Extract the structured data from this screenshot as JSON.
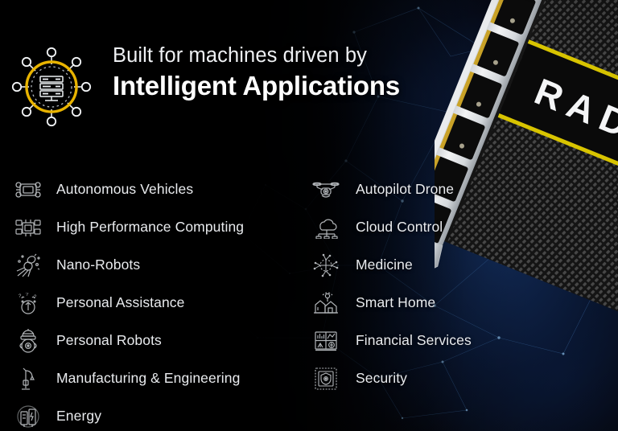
{
  "header": {
    "logo_icon": "server-network-logo-icon",
    "subtitle": "Built for machines driven by",
    "title": "Intelligent Applications"
  },
  "colors": {
    "accent_gold": "#e8b300",
    "background": "#000000",
    "nebula_blue": "#122c5a",
    "text_primary": "#ffffff",
    "text_secondary": "#e9ebee",
    "card_yellow": "#d8c400"
  },
  "hardware": {
    "product_text": "RADE",
    "name": "radeon-gpu-card"
  },
  "lists": {
    "left_column": [
      {
        "icon": "autonomous-vehicle-icon",
        "label": "Autonomous Vehicles"
      },
      {
        "icon": "high-performance-computing-icon",
        "label": "High Performance Computing"
      },
      {
        "icon": "nano-robot-icon",
        "label": "Nano-Robots"
      },
      {
        "icon": "personal-assistance-icon",
        "label": "Personal Assistance"
      },
      {
        "icon": "personal-robot-icon",
        "label": "Personal Robots"
      },
      {
        "icon": "manufacturing-engineering-icon",
        "label": "Manufacturing & Engineering"
      },
      {
        "icon": "energy-icon",
        "label": "Energy"
      }
    ],
    "right_column": [
      {
        "icon": "autopilot-drone-icon",
        "label": "Autopilot Drone"
      },
      {
        "icon": "cloud-control-icon",
        "label": "Cloud Control"
      },
      {
        "icon": "medicine-icon",
        "label": "Medicine"
      },
      {
        "icon": "smart-home-icon",
        "label": "Smart Home"
      },
      {
        "icon": "financial-services-icon",
        "label": "Financial Services"
      },
      {
        "icon": "security-icon",
        "label": "Security"
      }
    ]
  }
}
